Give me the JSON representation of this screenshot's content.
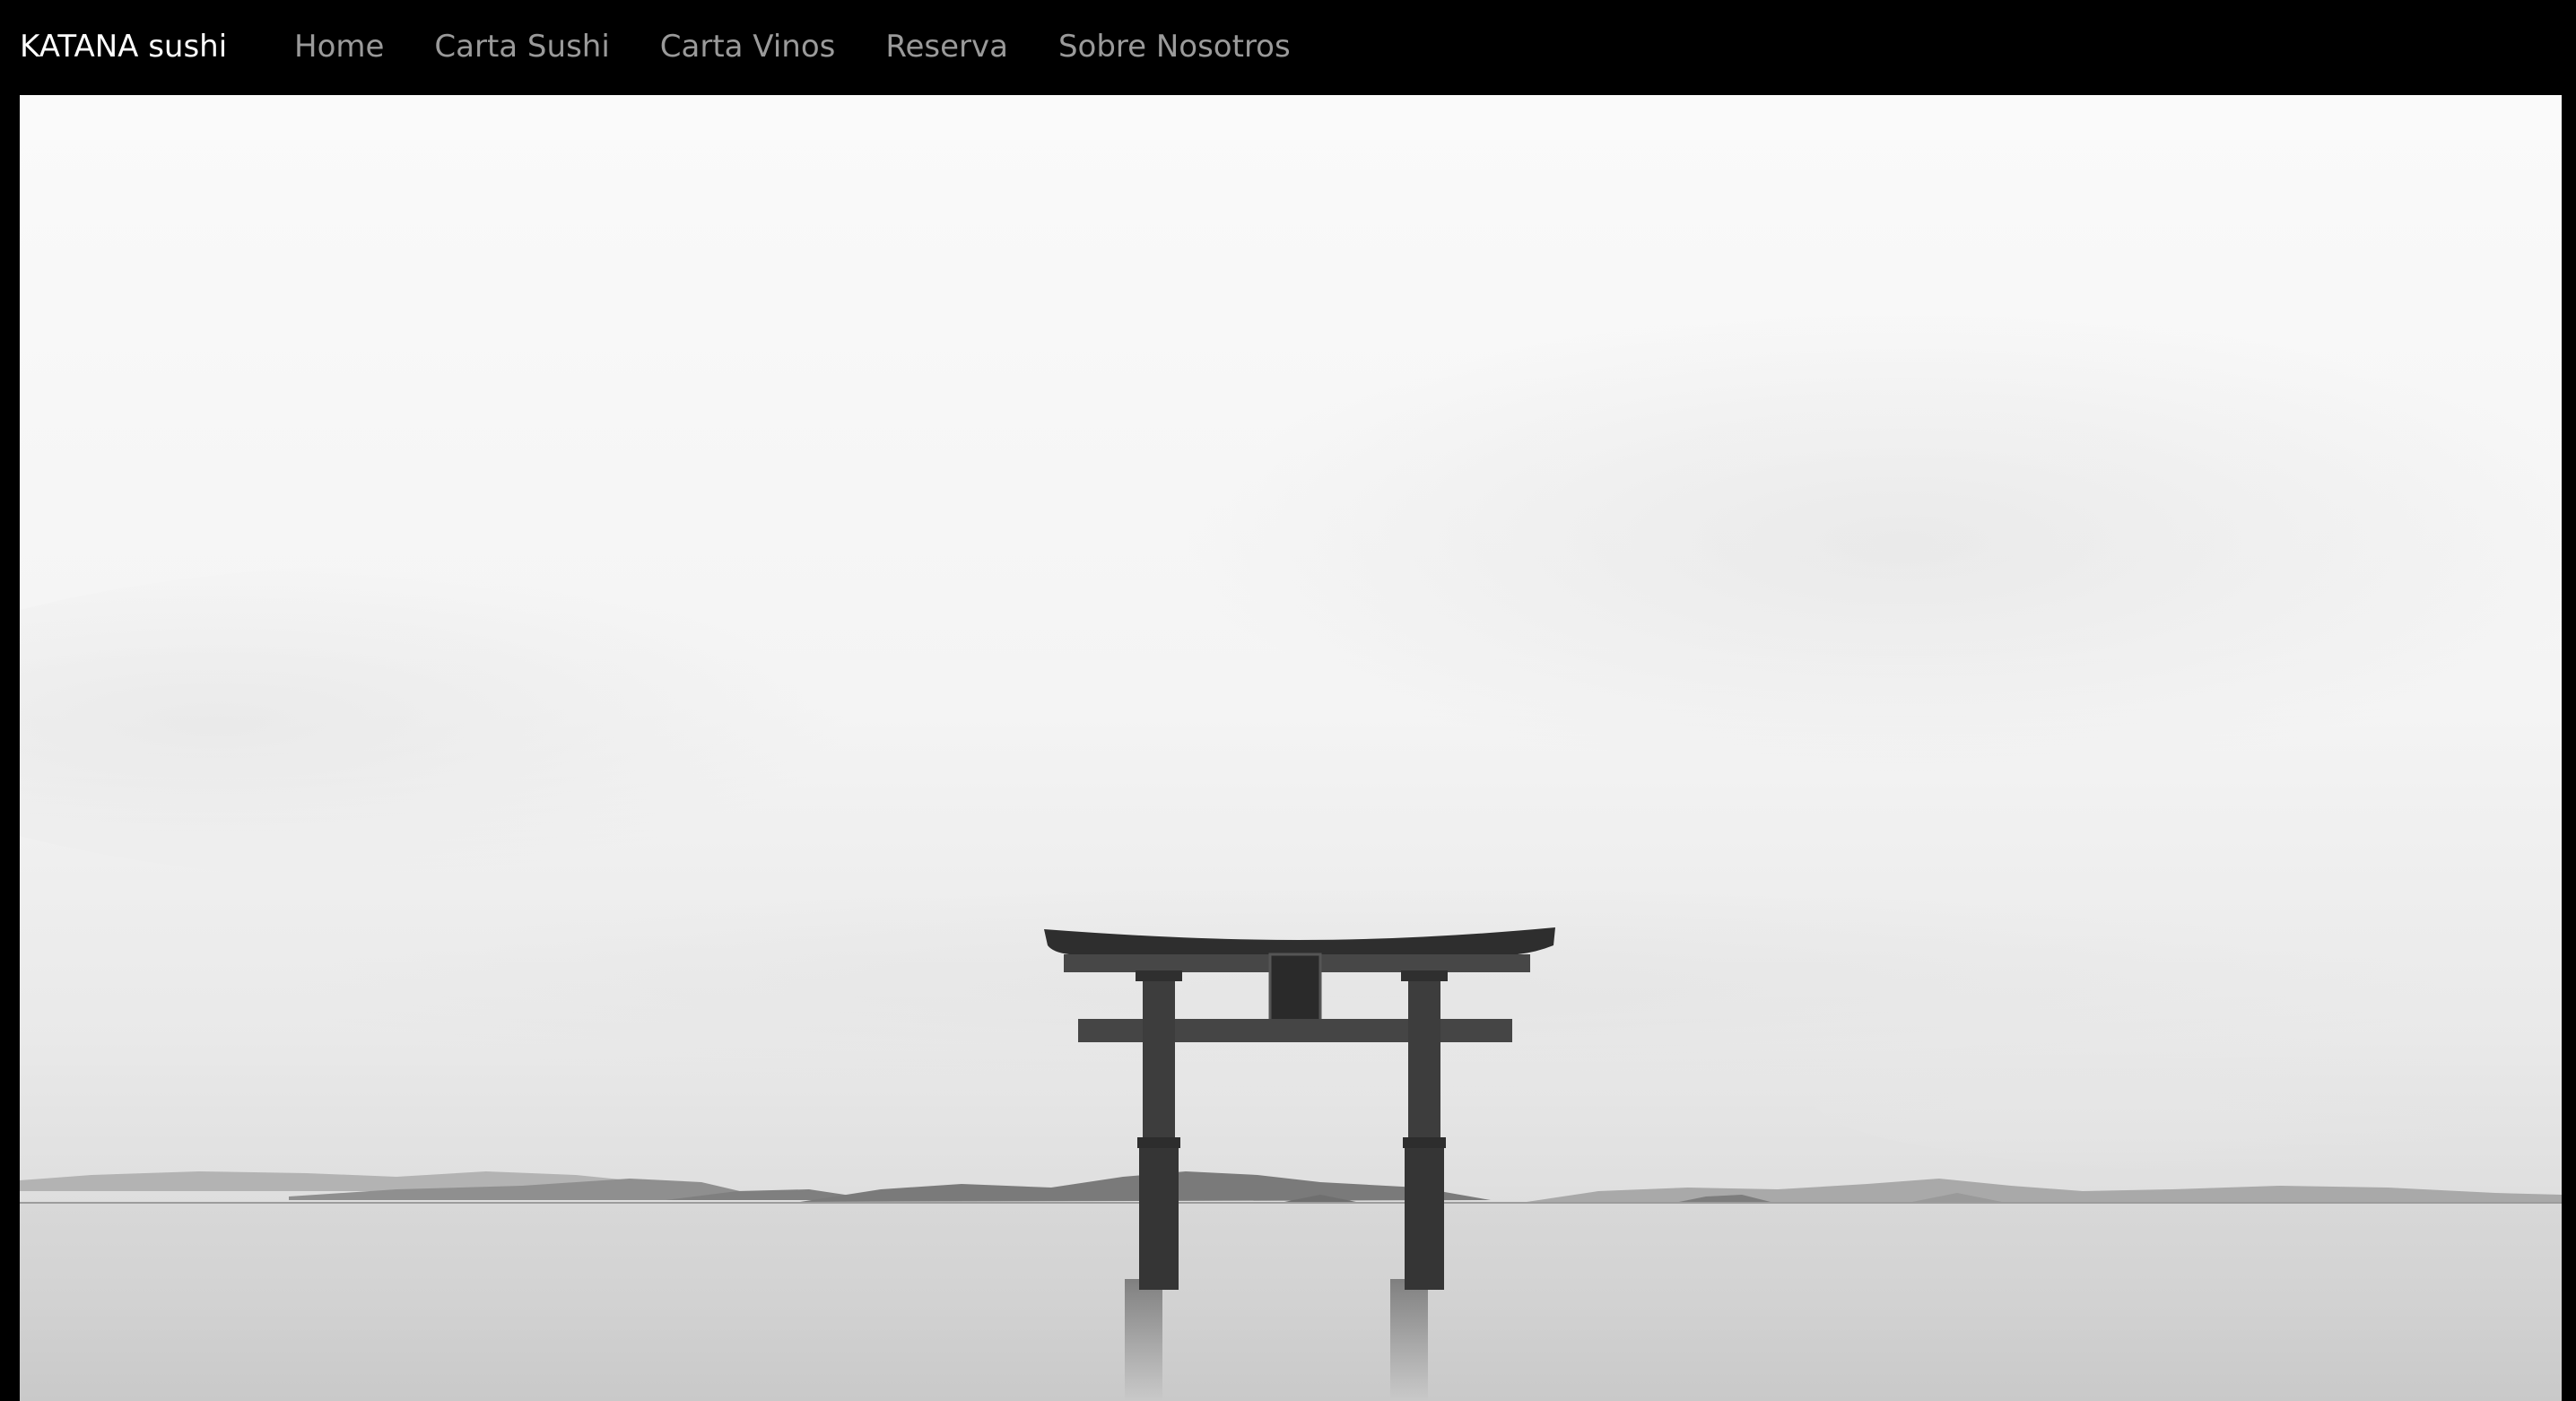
{
  "navbar": {
    "brand": "KATANA sushi",
    "links": [
      {
        "label": "Home"
      },
      {
        "label": "Carta Sushi"
      },
      {
        "label": "Carta Vinos"
      },
      {
        "label": "Reserva"
      },
      {
        "label": "Sobre Nosotros"
      }
    ]
  },
  "hero": {
    "image": "torii-gate-on-lake-photo"
  },
  "colors": {
    "navbar_bg": "#000000",
    "brand_text": "#ffffff",
    "nav_link_text": "#9a9a9a"
  }
}
